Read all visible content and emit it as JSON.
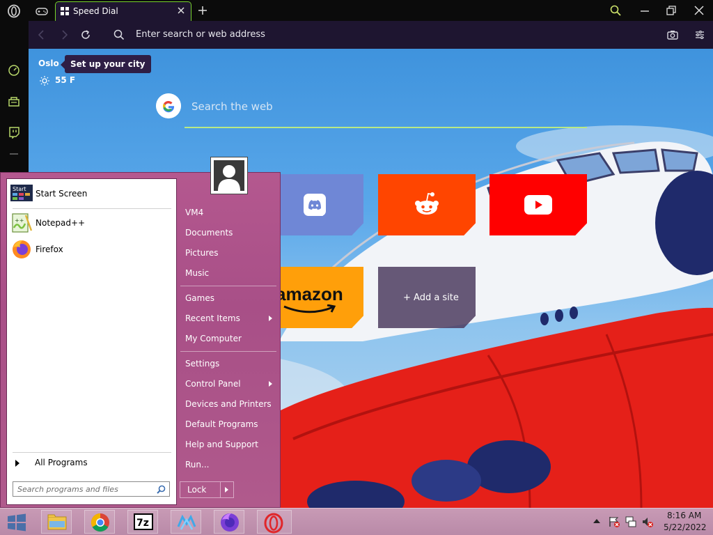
{
  "browser": {
    "tab_title": "Speed Dial",
    "address_placeholder": "Enter search or web address"
  },
  "speed_dial": {
    "city": "Oslo",
    "city_tooltip": "Set up your city",
    "temperature": "55 F",
    "search_placeholder": "Search the web",
    "tiles": [
      {
        "name": "Discord",
        "color": "#6f87d6"
      },
      {
        "name": "Reddit",
        "color": "#ff4500"
      },
      {
        "name": "YouTube",
        "color": "#ff0000"
      },
      {
        "name": "amazon",
        "color": "#ff9f0a"
      },
      {
        "name": "+ Add a site",
        "color": "#4e3c60"
      }
    ]
  },
  "start_menu": {
    "programs": [
      {
        "label": "Start Screen",
        "icon": "start-screen-icon"
      },
      {
        "label": "Notepad++",
        "icon": "notepadpp-icon"
      },
      {
        "label": "Firefox",
        "icon": "firefox-icon"
      }
    ],
    "all_programs": "All Programs",
    "search_placeholder": "Search programs and files",
    "right_items": [
      {
        "label": "VM4"
      },
      {
        "label": "Documents"
      },
      {
        "label": "Pictures"
      },
      {
        "label": "Music"
      },
      {
        "label": "Games"
      },
      {
        "label": "Recent Items",
        "submenu": true
      },
      {
        "label": "My Computer"
      },
      {
        "label": "Settings"
      },
      {
        "label": "Control Panel",
        "submenu": true
      },
      {
        "label": "Devices and Printers"
      },
      {
        "label": "Default Programs"
      },
      {
        "label": "Help and Support"
      },
      {
        "label": "Run..."
      }
    ],
    "lock_label": "Lock"
  },
  "taskbar": {
    "pinned": [
      "file-explorer-icon",
      "chrome-icon",
      "7zip-icon",
      "app-icon",
      "firefox-icon",
      "opera-icon"
    ],
    "time": "8:16 AM",
    "date": "5/22/2022"
  },
  "colors": {
    "accent_green": "#78d52a",
    "browser_bar": "#1e1530",
    "start_menu": "#b4588f"
  }
}
